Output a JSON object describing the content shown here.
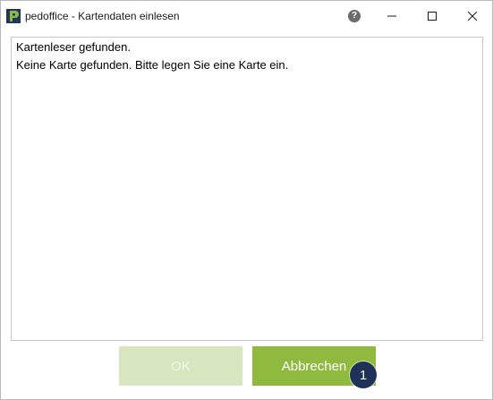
{
  "window": {
    "title": "pedoffice - Kartendaten einlesen",
    "app_icon": "pedoffice-logo-icon",
    "controls": {
      "help": "?",
      "minimize_icon": "minimize-icon",
      "maximize_icon": "maximize-icon",
      "close_icon": "close-icon"
    }
  },
  "content": {
    "lines": [
      "Kartenleser gefunden.",
      "Keine Karte gefunden. Bitte legen Sie eine Karte ein."
    ]
  },
  "buttons": {
    "ok_label": "OK",
    "cancel_label": "Abbrechen"
  },
  "badge": {
    "number": "1"
  },
  "colors": {
    "accent_green": "#8fba3f",
    "disabled_green": "#d8e6bf",
    "badge_navy": "#1e3158"
  }
}
